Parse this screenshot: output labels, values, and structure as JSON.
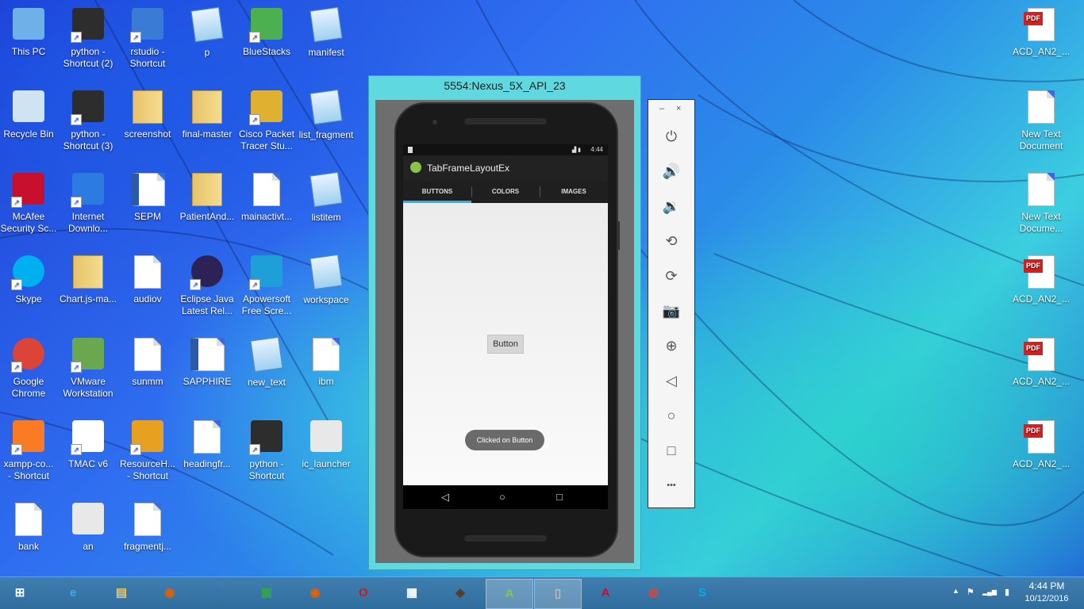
{
  "desktop": {
    "icons": [
      {
        "label": "This PC",
        "icon": "this-pc-icon",
        "shortcut": false
      },
      {
        "label": "python -\nShortcut (2)",
        "icon": "python-icon",
        "shortcut": true
      },
      {
        "label": "rstudio -\nShortcut",
        "icon": "rstudio-icon",
        "shortcut": true
      },
      {
        "label": "p",
        "icon": "text-document-icon",
        "shortcut": false
      },
      {
        "label": "BlueStacks",
        "icon": "bluestacks-icon",
        "shortcut": true
      },
      {
        "label": "manifest",
        "icon": "text-document-icon",
        "shortcut": false
      },
      {
        "label": "Recycle Bin",
        "icon": "recycle-bin-icon",
        "shortcut": false
      },
      {
        "label": "python -\nShortcut (3)",
        "icon": "python-icon",
        "shortcut": true
      },
      {
        "label": "screenshot",
        "icon": "folder-icon",
        "shortcut": false
      },
      {
        "label": "final-master",
        "icon": "folder-icon",
        "shortcut": false
      },
      {
        "label": "Cisco Packet\nTracer Stu...",
        "icon": "cisco-packet-tracer-icon",
        "shortcut": true
      },
      {
        "label": "list_fragment",
        "icon": "text-document-icon",
        "shortcut": false
      },
      {
        "label": "McAfee\nSecurity Sc...",
        "icon": "mcafee-icon",
        "shortcut": true
      },
      {
        "label": "Internet\nDownlo...",
        "icon": "internet-download-manager-icon",
        "shortcut": true
      },
      {
        "label": "SEPM",
        "icon": "word-document-icon",
        "shortcut": false
      },
      {
        "label": "PatientAnd...",
        "icon": "folder-icon",
        "shortcut": false
      },
      {
        "label": "mainactivt...",
        "icon": "blank-file-icon",
        "shortcut": false
      },
      {
        "label": "listitem",
        "icon": "text-document-icon",
        "shortcut": false
      },
      {
        "label": "Skype",
        "icon": "skype-icon",
        "shortcut": true
      },
      {
        "label": "Chart.js-ma...",
        "icon": "folder-icon",
        "shortcut": false
      },
      {
        "label": "audiov",
        "icon": "python-file-icon",
        "shortcut": false
      },
      {
        "label": "Eclipse Java\nLatest Rel...",
        "icon": "eclipse-icon",
        "shortcut": true
      },
      {
        "label": "Apowersoft\nFree Scre...",
        "icon": "apowersoft-icon",
        "shortcut": true
      },
      {
        "label": "workspace",
        "icon": "text-document-icon",
        "shortcut": false
      },
      {
        "label": "Google\nChrome",
        "icon": "chrome-icon",
        "shortcut": true
      },
      {
        "label": "VMware\nWorkstation",
        "icon": "vmware-icon",
        "shortcut": true
      },
      {
        "label": "sunmm",
        "icon": "text-file-icon",
        "shortcut": false
      },
      {
        "label": "SAPPHIRE",
        "icon": "word-document-icon",
        "shortcut": false
      },
      {
        "label": "new_text",
        "icon": "text-document-icon",
        "shortcut": false
      },
      {
        "label": "ibm",
        "icon": "text-file-icon",
        "shortcut": false
      },
      {
        "label": "xampp-co...\n- Shortcut",
        "icon": "xampp-icon",
        "shortcut": true
      },
      {
        "label": "TMAC v6",
        "icon": "tmac-icon",
        "shortcut": true
      },
      {
        "label": "ResourceH...\n- Shortcut",
        "icon": "resource-hacker-icon",
        "shortcut": true
      },
      {
        "label": "headingfr...",
        "icon": "blank-file-icon",
        "shortcut": false
      },
      {
        "label": "python -\nShortcut",
        "icon": "python-icon",
        "shortcut": true
      },
      {
        "label": "ic_launcher",
        "icon": "image-icon",
        "shortcut": false
      },
      {
        "label": "bank",
        "icon": "text-file-icon",
        "shortcut": false
      },
      {
        "label": "an",
        "icon": "image-icon",
        "shortcut": false
      },
      {
        "label": "fragmentj...",
        "icon": "blank-file-icon",
        "shortcut": false
      },
      {
        "label": "ACD_AN2_...",
        "icon": "pdf-icon",
        "shortcut": false
      },
      {
        "label": "New Text\nDocument",
        "icon": "text-file-icon",
        "shortcut": false
      },
      {
        "label": "New Text\nDocume...",
        "icon": "text-file-icon",
        "shortcut": false
      },
      {
        "label": "ACD_AN2_...",
        "icon": "pdf-icon",
        "shortcut": false
      },
      {
        "label": "ACD_AN2_...",
        "icon": "pdf-icon",
        "shortcut": false
      },
      {
        "label": "ACD_AN2_...",
        "icon": "pdf-icon",
        "shortcut": false
      }
    ]
  },
  "emulator": {
    "title": "5554:Nexus_5X_API_23",
    "status_time": "4:44",
    "app_title": "TabFrameLayoutEx",
    "tabs": [
      "BUTTONS",
      "COLORS",
      "IMAGES"
    ],
    "active_tab": 0,
    "button_label": "Button",
    "toast": "Clicked on Button",
    "nav": {
      "back": "◁",
      "home": "○",
      "recents": "□"
    }
  },
  "emulator_toolbar": {
    "minimize": "–",
    "close": "×",
    "buttons": [
      {
        "name": "power-icon",
        "glyph": "⏻"
      },
      {
        "name": "volume-up-icon",
        "glyph": "🔊"
      },
      {
        "name": "volume-down-icon",
        "glyph": "🔉"
      },
      {
        "name": "rotate-left-icon",
        "glyph": "⟲"
      },
      {
        "name": "rotate-right-icon",
        "glyph": "⟳"
      },
      {
        "name": "camera-icon",
        "glyph": "📷"
      },
      {
        "name": "zoom-icon",
        "glyph": "⊕"
      },
      {
        "name": "back-icon",
        "glyph": "◁"
      },
      {
        "name": "home-icon",
        "glyph": "○"
      },
      {
        "name": "overview-icon",
        "glyph": "□"
      },
      {
        "name": "more-icon",
        "glyph": "•••"
      }
    ]
  },
  "taskbar": {
    "items": [
      {
        "name": "start-button",
        "glyph": "⊞"
      },
      {
        "name": "internet-explorer-icon",
        "glyph": "e"
      },
      {
        "name": "file-explorer-icon",
        "glyph": "▤"
      },
      {
        "name": "firefox-icon",
        "glyph": "◉"
      },
      {
        "name": "sync-app-icon",
        "glyph": "◎"
      },
      {
        "name": "store-icon",
        "glyph": "▦"
      },
      {
        "name": "firefox-icon-2",
        "glyph": "◉"
      },
      {
        "name": "opera-icon",
        "glyph": "O"
      },
      {
        "name": "apps-grid-icon",
        "glyph": "▦"
      },
      {
        "name": "media-player-icon",
        "glyph": "◈"
      },
      {
        "name": "android-studio-icon",
        "glyph": "A"
      },
      {
        "name": "android-emulator-icon",
        "glyph": "▯"
      },
      {
        "name": "acrobat-icon",
        "glyph": "A"
      },
      {
        "name": "chrome-icon",
        "glyph": "◍"
      },
      {
        "name": "skype-icon",
        "glyph": "S"
      }
    ],
    "active_indices": [
      10,
      11
    ],
    "tray": {
      "up_arrow": "▲",
      "flag": "⚑",
      "signal": "▂▄▆",
      "battery": "▮"
    },
    "time": "4:44 PM",
    "date": "10/12/2016"
  },
  "colors": {
    "emulator_frame": "#5fd8e0",
    "tab_indicator": "#1eb8e8",
    "toast_bg": "#6a6a6a",
    "taskbar": "#2f6d9d"
  }
}
